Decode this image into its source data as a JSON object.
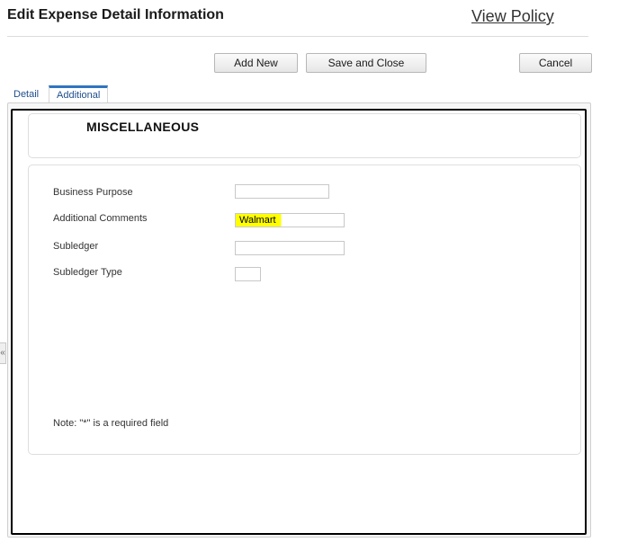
{
  "header": {
    "title": "Edit Expense Detail Information",
    "view_policy_link": "View Policy"
  },
  "toolbar": {
    "add_new_label": "Add New",
    "save_close_label": "Save and Close",
    "cancel_label": "Cancel"
  },
  "tabs": [
    {
      "label": "Detail",
      "active": false
    },
    {
      "label": "Additional",
      "active": true
    }
  ],
  "section": {
    "title": "MISCELLANEOUS"
  },
  "form": {
    "fields": [
      {
        "label": "Business Purpose",
        "value": ""
      },
      {
        "label": "Additional Comments",
        "value": "Walmart"
      },
      {
        "label": "Subledger",
        "value": ""
      },
      {
        "label": "Subledger Type",
        "value": ""
      }
    ],
    "note": "Note: \"*\" is a required field"
  },
  "colors": {
    "tab_accent": "#2f75c0",
    "highlight": "#ffff00",
    "link_text": "#1f4e8c"
  },
  "icons": {
    "collapse_handle": "double-chevron-left-icon"
  }
}
